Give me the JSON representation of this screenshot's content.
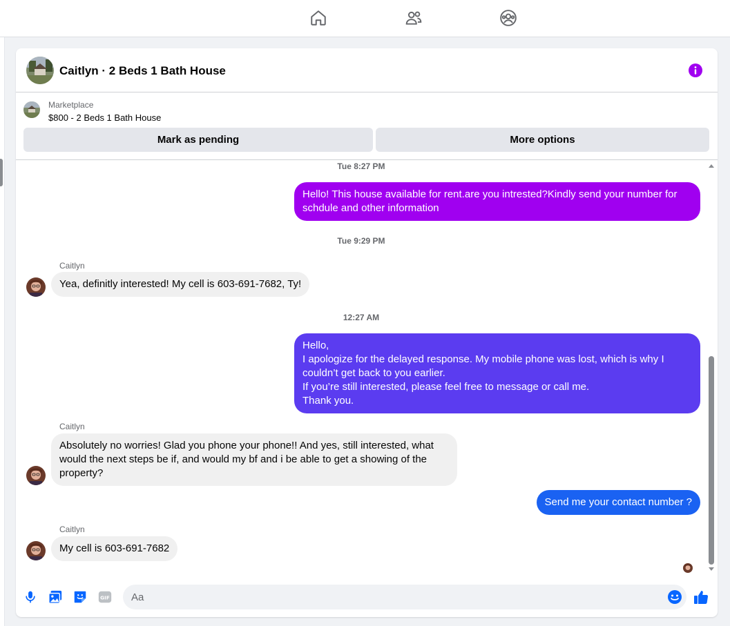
{
  "nav": {
    "icons": [
      "home-icon",
      "friends-icon",
      "groups-icon"
    ]
  },
  "header": {
    "title": "Caitlyn · 2 Beds 1 Bath House",
    "info_icon": "info-icon"
  },
  "listing": {
    "source": "Marketplace",
    "price_title": "$800 - 2 Beds 1 Bath House",
    "mark_pending_label": "Mark as pending",
    "more_options_label": "More options"
  },
  "messages": {
    "timestamps": [
      "Tue 8:27 PM",
      "Tue 9:29 PM",
      "12:27 AM"
    ],
    "sender_name": "Caitlyn",
    "m1": "Hello! This house available for rent.are you intrested?Kindly send your number for\nschdule and other information",
    "m2": "Yea, definitly interested! My cell is 603-691-7682, Ty!",
    "m3": "Hello,\nI apologize for the delayed response. My mobile phone was lost, which is why I\ncouldn’t get back to you earlier.\nIf you’re still interested, please feel free to message or call me.\nThank you.",
    "m4": "Absolutely no worries! Glad you phone your phone!! And yes, still interested, what\nwould the next steps be if, and would my bf and i be able to get a showing of the\nproperty?",
    "m5": "Send me your contact number ?",
    "m6": "My cell is 603-691-7682"
  },
  "composer": {
    "placeholder": "Aa",
    "value": "",
    "icons": [
      "microphone-icon",
      "photo-icon",
      "sticker-icon",
      "gif-icon",
      "emoji-icon",
      "like-icon"
    ]
  },
  "colors": {
    "accent": "#0866ff",
    "gradient_top": "#a000f0",
    "gradient_mid": "#5b3cf0",
    "gradient_bottom": "#1a62f2",
    "incoming_bubble": "#f0f0f0"
  }
}
